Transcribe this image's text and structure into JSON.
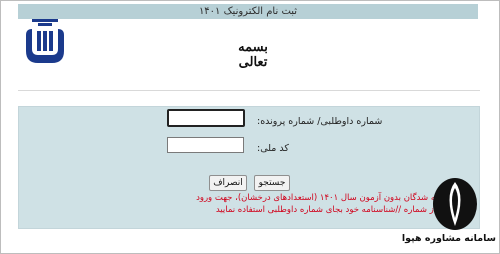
{
  "header": {
    "title": "ثبت نام الکترونیک ۱۴۰۱",
    "bismillah": "بسمه تعالی"
  },
  "form": {
    "file_label": "شماره داوطلبی/ شماره پرونده:",
    "file_value": "",
    "code_label": "کد ملی:",
    "code_value": "",
    "search_label": "جستجو",
    "cancel_label": "انصراف",
    "notice": "پذیرفته شدگان بدون آزمون سال ۱۴۰۱ (استعدادهای درخشان)، جهت ورود از شماره //شناسنامه خود بجای شماره داوطلبی استفاده نمایید"
  },
  "watermark": {
    "text": "سامانه مشاوره هپوا"
  },
  "colors": {
    "topbar": "#b7d0d6",
    "panel": "#cfe1e5",
    "notice": "#d0021b"
  }
}
